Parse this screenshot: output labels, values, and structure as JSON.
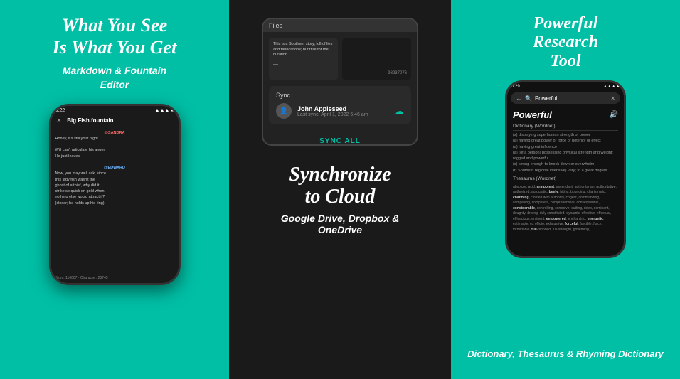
{
  "panels": {
    "left": {
      "title_line1": "What You See",
      "title_line2": "Is What You Get",
      "subtitle": "Markdown & Fountain\nEditor",
      "phone": {
        "time": "5:22",
        "filename": "Big Fish.fountain",
        "content": [
          {
            "type": "char",
            "name": "@SANDRA"
          },
          {
            "type": "text",
            "text": "Honey, it's still your night."
          },
          {
            "type": "text",
            "text": ""
          },
          {
            "type": "text",
            "text": "Will can't articulate his anger."
          },
          {
            "type": "text",
            "text": "He just leaves."
          },
          {
            "type": "text",
            "text": ""
          },
          {
            "type": "char",
            "name": "@EDWARD"
          },
          {
            "type": "text",
            "text": "Now, you may well ask, since"
          },
          {
            "type": "text",
            "text": "this lady fish wasn't the"
          },
          {
            "type": "text",
            "text": "ghost of a thief, why did it"
          },
          {
            "type": "text",
            "text": "strike so quick on gold when"
          },
          {
            "type": "text",
            "text": "nothing else would attract it?"
          },
          {
            "type": "text",
            "text": "(closer; he holds up his ring)"
          }
        ],
        "word_count": "Word: 116007 · Character: 23745"
      }
    },
    "middle": {
      "files_label": "Files",
      "file1": {
        "text": "This is a Southern story, full of lies and fabrications; but true for the duration."
      },
      "file2": {
        "text": "98237076"
      },
      "sync_label": "Sync",
      "user_name": "John Appleseed",
      "last_sync": "Last sync: April 1, 2022 6:46 am",
      "sync_all_btn": "SYNC ALL",
      "bottom_title_line1": "Synchronize",
      "bottom_title_line2": "to Cloud",
      "bottom_subtitle": "Google Drive, Dropbox &\nOneDrive"
    },
    "right": {
      "title_line1": "Powerful",
      "title_line2": "Research",
      "title_line3": "Tool",
      "phone": {
        "time": "6:29",
        "search_text": "Powerful",
        "word": "Powerful",
        "dict_section": "Dictionary (Wordnet)",
        "definitions": [
          "(s) displaying superhuman strength or power",
          "(a) having great power or force or potency or effect",
          "(a) having great influence",
          "(a) (of a person) possessing physical strength and weight; rugged and powerful",
          "(s) strong enough to knock down or overwhelm",
          "(r) Southern regional intensive) very; to a great degree"
        ],
        "thesaurus_section": "Thesaurus (Wordnet)",
        "synonyms": "absolute, acid, arm potent, ascendant, authoritarian, authoritative, authorized, autocratic, beefy, biting, bouncing, charismatic, charming, clothed with authority, cogent, commanding, compelling, competent, comprehensive, consequential, considerable, controlling, corrosive, cutting, deep, dominant, doughty, driving, duly constituted, dynamic, effective, effectual, efficacious, eminent, empowered, enchanting, energetic, estimable, ex officio, exhaustive, forceful, forcible, furcy, formidable, full-blooded, full-strength, governing,"
      },
      "subtitle": "Dictionary, Thesaurus &\nRhyming Dictionary"
    }
  }
}
